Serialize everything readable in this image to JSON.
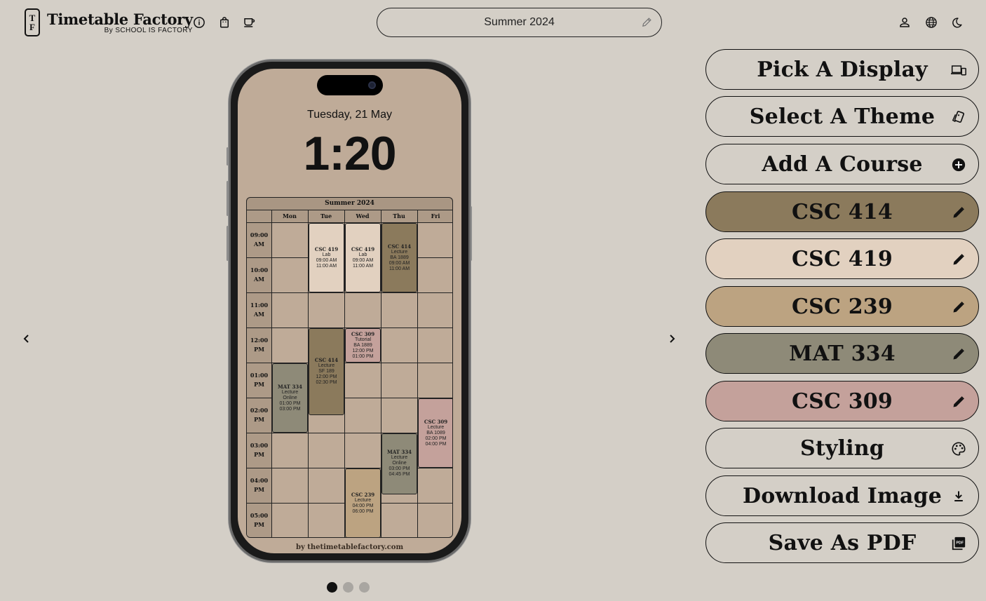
{
  "header": {
    "logo_mark_top": "T",
    "logo_mark_bottom": "F",
    "app_title": "Timetable Factory",
    "app_subtitle": "By SCHOOL IS FACTORY",
    "icons": [
      "info-icon",
      "shopping-bag-icon",
      "coffee-icon",
      "account-icon",
      "globe-icon",
      "dark-mode-icon"
    ],
    "timetable_title": "Summer 2024"
  },
  "phone": {
    "date": "Tuesday, 21 May",
    "time": "1:20",
    "timetable": {
      "title": "Summer 2024",
      "days": [
        "Mon",
        "Tue",
        "Wed",
        "Thu",
        "Fri"
      ],
      "times": [
        [
          "09:00",
          "AM"
        ],
        [
          "10:00",
          "AM"
        ],
        [
          "11:00",
          "AM"
        ],
        [
          "12:00",
          "PM"
        ],
        [
          "01:00",
          "PM"
        ],
        [
          "02:00",
          "PM"
        ],
        [
          "03:00",
          "PM"
        ],
        [
          "04:00",
          "PM"
        ],
        [
          "05:00",
          "PM"
        ]
      ],
      "events": [
        {
          "code": "CSC 419",
          "lines": [
            "Lab",
            "09:00 AM",
            "11:00 AM"
          ],
          "day": 1,
          "start": 9,
          "end": 11,
          "color": "#e2d1c0"
        },
        {
          "code": "CSC 419",
          "lines": [
            "Lab",
            "09:00 AM",
            "11:00 AM"
          ],
          "day": 2,
          "start": 9,
          "end": 11,
          "color": "#e2d1c0"
        },
        {
          "code": "CSC 414",
          "lines": [
            "Lecture",
            "BA 1889",
            "09:00 AM",
            "11:00 AM"
          ],
          "day": 3,
          "start": 9,
          "end": 11,
          "color": "#8b7a5c"
        },
        {
          "code": "CSC 309",
          "lines": [
            "Tutorial",
            "BA 1889",
            "12:00 PM",
            "01:00 PM"
          ],
          "day": 2,
          "start": 12,
          "end": 13,
          "color": "#c4a19b"
        },
        {
          "code": "CSC 414",
          "lines": [
            "Lecture",
            "SF 189",
            "12:00 PM",
            "02:30 PM"
          ],
          "day": 1,
          "start": 12,
          "end": 14.5,
          "color": "#8b7a5c"
        },
        {
          "code": "MAT 334",
          "lines": [
            "Lecture",
            "Online",
            "01:00 PM",
            "03:00 PM"
          ],
          "day": 0,
          "start": 13,
          "end": 15,
          "color": "#8e8a78"
        },
        {
          "code": "CSC 309",
          "lines": [
            "Lecture",
            "BA 1089",
            "02:00 PM",
            "04:00 PM"
          ],
          "day": 4,
          "start": 14,
          "end": 16,
          "color": "#c4a19b"
        },
        {
          "code": "MAT 334",
          "lines": [
            "Lecture",
            "Online",
            "03:00 PM",
            "04:45 PM"
          ],
          "day": 3,
          "start": 15,
          "end": 16.75,
          "color": "#8e8a78"
        },
        {
          "code": "CSC 239",
          "lines": [
            "Lecture",
            "04:00 PM",
            "06:00 PM"
          ],
          "day": 2,
          "start": 16,
          "end": 18,
          "color": "#bca381"
        }
      ]
    },
    "credit": "by thetimetablefactory.com"
  },
  "carousel": {
    "pages": 3,
    "active": 0
  },
  "panel": {
    "buttons": [
      {
        "label": "Pick A Display",
        "icon": "devices-icon",
        "color": "transparent"
      },
      {
        "label": "Select A Theme",
        "icon": "theme-cards-icon",
        "color": "transparent"
      },
      {
        "label": "Add A Course",
        "icon": "add-circle-icon",
        "color": "transparent"
      },
      {
        "label": "CSC 414",
        "icon": "pencil-icon",
        "color": "#8b7a5c"
      },
      {
        "label": "CSC 419",
        "icon": "pencil-icon",
        "color": "#e2d1c0"
      },
      {
        "label": "CSC 239",
        "icon": "pencil-icon",
        "color": "#bca381"
      },
      {
        "label": "MAT 334",
        "icon": "pencil-icon",
        "color": "#8e8a78"
      },
      {
        "label": "CSC 309",
        "icon": "pencil-icon",
        "color": "#c4a19b"
      },
      {
        "label": "Styling",
        "icon": "palette-icon",
        "color": "transparent"
      },
      {
        "label": "Download Image",
        "icon": "download-icon",
        "color": "transparent"
      },
      {
        "label": "Save As PDF",
        "icon": "pdf-icon",
        "color": "transparent"
      }
    ]
  }
}
